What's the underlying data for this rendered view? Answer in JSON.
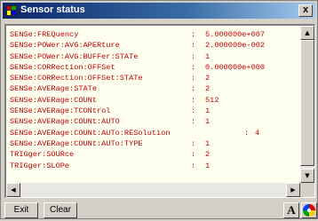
{
  "window": {
    "title": "Sensor status",
    "close_label": "x"
  },
  "status_lines": [
    {
      "command": "SENSe:FREQuency",
      "separator": ":",
      "value": "5.000000e+007"
    },
    {
      "command": "SENSe:POWer:AVG:APERture",
      "separator": ":",
      "value": "2.000000e-002"
    },
    {
      "command": "SENSe:POWer:AVG:BUFFer:STATe",
      "separator": ":",
      "value": "1"
    },
    {
      "command": "SENSe:CORRection:OFFSet",
      "separator": ":",
      "value": "0.000000e+000"
    },
    {
      "command": "SENSe:CORRection:OFFSet:STATe",
      "separator": ":",
      "value": "2"
    },
    {
      "command": "SENSe:AVERage:STATe",
      "separator": ":",
      "value": "2"
    },
    {
      "command": "SENSe:AVERage:COUNt",
      "separator": ":",
      "value": "512"
    },
    {
      "command": "SENSe:AVERage:TCONtrol",
      "separator": ":",
      "value": "1"
    },
    {
      "command": "SENSe:AVERage:COUNt:AUTO",
      "separator": ":",
      "value": "1"
    },
    {
      "command": "SENSe:AVERage:COUNt:AUTo:RESolution",
      "separator": ":",
      "value": "4"
    },
    {
      "command": "SENSe:AVERage:COUNt:AUTo:TYPE",
      "separator": ":",
      "value": "1"
    },
    {
      "command": "TRIGger:SOURce",
      "separator": ":",
      "value": "2"
    },
    {
      "command": "TRIGger:SLOPe",
      "separator": ":",
      "value": "1"
    }
  ],
  "scrollbar": {
    "up_arrow": "▲",
    "down_arrow": "▼",
    "left_arrow": "◀",
    "right_arrow": "▶"
  },
  "buttons": {
    "exit_label": "Exit",
    "clear_label": "Clear",
    "font_label": "A"
  },
  "colors": {
    "text": "#c00000",
    "text_background": "#fffff0",
    "title_bar": "#0a246a"
  }
}
